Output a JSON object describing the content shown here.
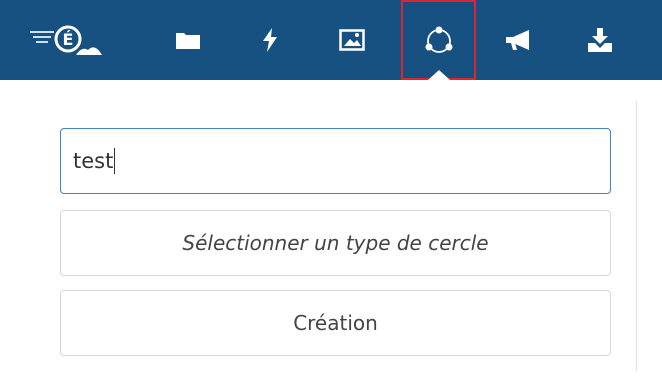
{
  "toolbar": {
    "logo_name": "academy-logo",
    "icons": [
      "folder-icon",
      "lightning-icon",
      "image-icon",
      "share-circle-icon",
      "megaphone-icon",
      "download-icon"
    ],
    "active_icon": "share-circle-icon",
    "background_color": "#175182",
    "active_border_color": "#d92632"
  },
  "form": {
    "name_value": "test",
    "circle_type_placeholder": "Sélectionner un type de cercle",
    "create_label": "Création"
  }
}
